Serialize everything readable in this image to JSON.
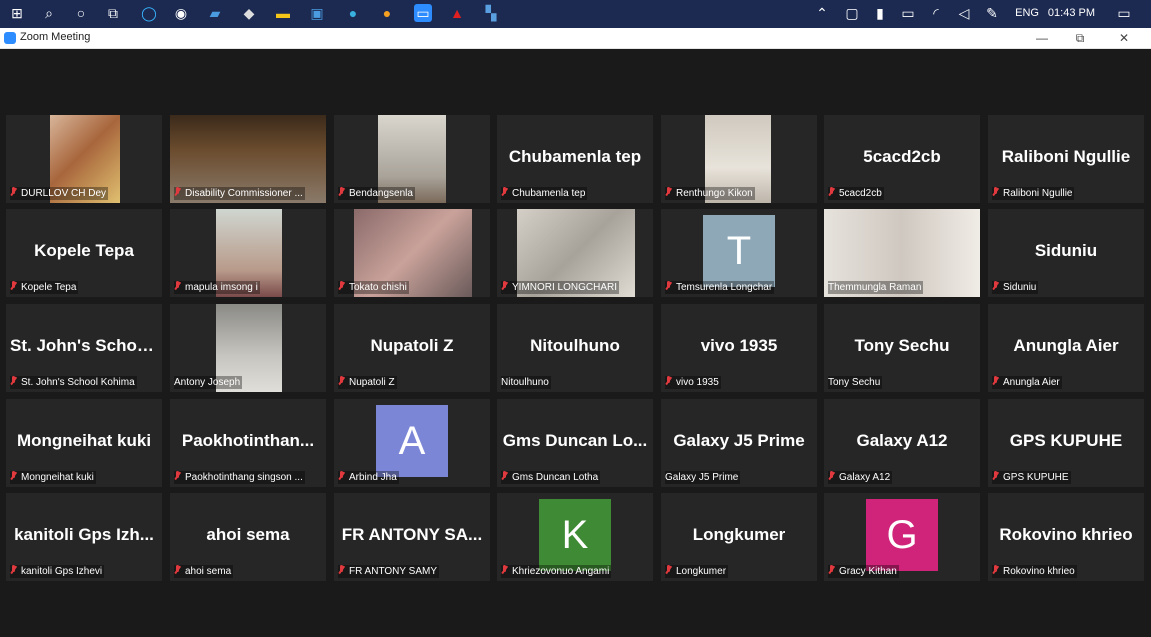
{
  "taskbar": {
    "language": "ENG",
    "time": "01:43 PM"
  },
  "window": {
    "title": "Zoom Meeting"
  },
  "colors": {
    "accent": "#2d8cff",
    "active_speaker_border": "#c4e45a",
    "muted_icon": "#e0393e",
    "avatar_A": "#7b86d6",
    "avatar_T": "#8ea8b8",
    "avatar_K": "#3f8a34",
    "avatar_G": "#d0237a"
  },
  "participants": [
    {
      "label": "DURLLOV CH Dey",
      "muted": true,
      "video": true
    },
    {
      "label": "Disability Commissioner ...",
      "muted": true,
      "video": true
    },
    {
      "label": "Bendangsenla",
      "muted": true,
      "video": true
    },
    {
      "display": "Chubamenla tep",
      "label": "Chubamenla tep",
      "muted": true
    },
    {
      "label": "Renthungo Kikon",
      "muted": true,
      "video": true
    },
    {
      "display": "5cacd2cb",
      "label": "5cacd2cb",
      "muted": true
    },
    {
      "display": "Raliboni Ngullie",
      "label": "Raliboni Ngullie",
      "muted": true
    },
    {
      "display": "Kopele Tepa",
      "label": "Kopele Tepa",
      "muted": true
    },
    {
      "label": "mapula imsong i",
      "muted": true,
      "video": true
    },
    {
      "label": "Tokato chishi",
      "muted": true,
      "video": true
    },
    {
      "label": "YIMNORI LONGCHARI",
      "muted": true,
      "video": true
    },
    {
      "label": "Temsurenla Longchar",
      "muted": true,
      "avatar": "T"
    },
    {
      "label": "Themmungla Raman",
      "muted": false,
      "video": true,
      "active": true
    },
    {
      "display": "Siduniu",
      "label": "Siduniu",
      "muted": true
    },
    {
      "display": "St. John's Schoo...",
      "label": "St. John's School Kohima",
      "muted": true
    },
    {
      "label": "Antony Joseph",
      "muted": false,
      "video": true
    },
    {
      "display": "Nupatoli Z",
      "label": "Nupatoli Z",
      "muted": true
    },
    {
      "display": "Nitoulhuno",
      "label": "Nitoulhuno",
      "muted": false
    },
    {
      "display": "vivo 1935",
      "label": "vivo 1935",
      "muted": true
    },
    {
      "display": "Tony Sechu",
      "label": "Tony Sechu",
      "muted": false
    },
    {
      "display": "Anungla Aier",
      "label": "Anungla Aier",
      "muted": true
    },
    {
      "display": "Mongneihat kuki",
      "label": "Mongneihat kuki",
      "muted": true
    },
    {
      "display": "Paokhotinthan...",
      "label": "Paokhotinthang singson ...",
      "muted": true
    },
    {
      "label": "Arbind Jha",
      "muted": true,
      "avatar": "A"
    },
    {
      "display": "Gms Duncan Lo...",
      "label": "Gms Duncan Lotha",
      "muted": true
    },
    {
      "display": "Galaxy J5 Prime",
      "label": "Galaxy J5 Prime",
      "muted": false
    },
    {
      "display": "Galaxy A12",
      "label": "Galaxy A12",
      "muted": true
    },
    {
      "display": "GPS KUPUHE",
      "label": "GPS KUPUHE",
      "muted": true
    },
    {
      "display": "kanitoli Gps Izh...",
      "label": "kanitoli Gps Izhevi",
      "muted": true
    },
    {
      "display": "ahoi sema",
      "label": "ahoi sema",
      "muted": true
    },
    {
      "display": "FR ANTONY SA...",
      "label": "FR ANTONY SAMY",
      "muted": true
    },
    {
      "label": "Khriezovonuo Angami",
      "muted": true,
      "avatar": "K"
    },
    {
      "display": "Longkumer",
      "label": "Longkumer",
      "muted": true
    },
    {
      "label": "Gracy Kithan",
      "muted": true,
      "avatar": "G"
    },
    {
      "display": "Rokovino khrieo",
      "label": "Rokovino khrieo",
      "muted": true
    }
  ]
}
